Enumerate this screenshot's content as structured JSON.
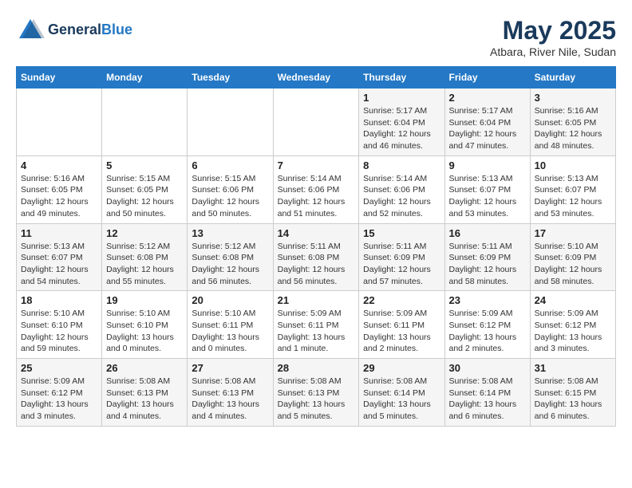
{
  "header": {
    "logo_line1": "General",
    "logo_line2": "Blue",
    "title": "May 2025",
    "subtitle": "Atbara, River Nile, Sudan"
  },
  "days_of_week": [
    "Sunday",
    "Monday",
    "Tuesday",
    "Wednesday",
    "Thursday",
    "Friday",
    "Saturday"
  ],
  "weeks": [
    [
      {
        "day": "",
        "info": ""
      },
      {
        "day": "",
        "info": ""
      },
      {
        "day": "",
        "info": ""
      },
      {
        "day": "",
        "info": ""
      },
      {
        "day": "1",
        "info": "Sunrise: 5:17 AM\nSunset: 6:04 PM\nDaylight: 12 hours\nand 46 minutes."
      },
      {
        "day": "2",
        "info": "Sunrise: 5:17 AM\nSunset: 6:04 PM\nDaylight: 12 hours\nand 47 minutes."
      },
      {
        "day": "3",
        "info": "Sunrise: 5:16 AM\nSunset: 6:05 PM\nDaylight: 12 hours\nand 48 minutes."
      }
    ],
    [
      {
        "day": "4",
        "info": "Sunrise: 5:16 AM\nSunset: 6:05 PM\nDaylight: 12 hours\nand 49 minutes."
      },
      {
        "day": "5",
        "info": "Sunrise: 5:15 AM\nSunset: 6:05 PM\nDaylight: 12 hours\nand 50 minutes."
      },
      {
        "day": "6",
        "info": "Sunrise: 5:15 AM\nSunset: 6:06 PM\nDaylight: 12 hours\nand 50 minutes."
      },
      {
        "day": "7",
        "info": "Sunrise: 5:14 AM\nSunset: 6:06 PM\nDaylight: 12 hours\nand 51 minutes."
      },
      {
        "day": "8",
        "info": "Sunrise: 5:14 AM\nSunset: 6:06 PM\nDaylight: 12 hours\nand 52 minutes."
      },
      {
        "day": "9",
        "info": "Sunrise: 5:13 AM\nSunset: 6:07 PM\nDaylight: 12 hours\nand 53 minutes."
      },
      {
        "day": "10",
        "info": "Sunrise: 5:13 AM\nSunset: 6:07 PM\nDaylight: 12 hours\nand 53 minutes."
      }
    ],
    [
      {
        "day": "11",
        "info": "Sunrise: 5:13 AM\nSunset: 6:07 PM\nDaylight: 12 hours\nand 54 minutes."
      },
      {
        "day": "12",
        "info": "Sunrise: 5:12 AM\nSunset: 6:08 PM\nDaylight: 12 hours\nand 55 minutes."
      },
      {
        "day": "13",
        "info": "Sunrise: 5:12 AM\nSunset: 6:08 PM\nDaylight: 12 hours\nand 56 minutes."
      },
      {
        "day": "14",
        "info": "Sunrise: 5:11 AM\nSunset: 6:08 PM\nDaylight: 12 hours\nand 56 minutes."
      },
      {
        "day": "15",
        "info": "Sunrise: 5:11 AM\nSunset: 6:09 PM\nDaylight: 12 hours\nand 57 minutes."
      },
      {
        "day": "16",
        "info": "Sunrise: 5:11 AM\nSunset: 6:09 PM\nDaylight: 12 hours\nand 58 minutes."
      },
      {
        "day": "17",
        "info": "Sunrise: 5:10 AM\nSunset: 6:09 PM\nDaylight: 12 hours\nand 58 minutes."
      }
    ],
    [
      {
        "day": "18",
        "info": "Sunrise: 5:10 AM\nSunset: 6:10 PM\nDaylight: 12 hours\nand 59 minutes."
      },
      {
        "day": "19",
        "info": "Sunrise: 5:10 AM\nSunset: 6:10 PM\nDaylight: 13 hours\nand 0 minutes."
      },
      {
        "day": "20",
        "info": "Sunrise: 5:10 AM\nSunset: 6:11 PM\nDaylight: 13 hours\nand 0 minutes."
      },
      {
        "day": "21",
        "info": "Sunrise: 5:09 AM\nSunset: 6:11 PM\nDaylight: 13 hours\nand 1 minute."
      },
      {
        "day": "22",
        "info": "Sunrise: 5:09 AM\nSunset: 6:11 PM\nDaylight: 13 hours\nand 2 minutes."
      },
      {
        "day": "23",
        "info": "Sunrise: 5:09 AM\nSunset: 6:12 PM\nDaylight: 13 hours\nand 2 minutes."
      },
      {
        "day": "24",
        "info": "Sunrise: 5:09 AM\nSunset: 6:12 PM\nDaylight: 13 hours\nand 3 minutes."
      }
    ],
    [
      {
        "day": "25",
        "info": "Sunrise: 5:09 AM\nSunset: 6:12 PM\nDaylight: 13 hours\nand 3 minutes."
      },
      {
        "day": "26",
        "info": "Sunrise: 5:08 AM\nSunset: 6:13 PM\nDaylight: 13 hours\nand 4 minutes."
      },
      {
        "day": "27",
        "info": "Sunrise: 5:08 AM\nSunset: 6:13 PM\nDaylight: 13 hours\nand 4 minutes."
      },
      {
        "day": "28",
        "info": "Sunrise: 5:08 AM\nSunset: 6:13 PM\nDaylight: 13 hours\nand 5 minutes."
      },
      {
        "day": "29",
        "info": "Sunrise: 5:08 AM\nSunset: 6:14 PM\nDaylight: 13 hours\nand 5 minutes."
      },
      {
        "day": "30",
        "info": "Sunrise: 5:08 AM\nSunset: 6:14 PM\nDaylight: 13 hours\nand 6 minutes."
      },
      {
        "day": "31",
        "info": "Sunrise: 5:08 AM\nSunset: 6:15 PM\nDaylight: 13 hours\nand 6 minutes."
      }
    ]
  ]
}
